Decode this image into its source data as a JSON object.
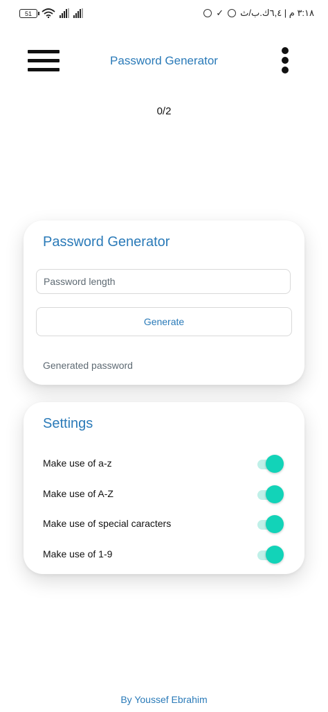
{
  "status_bar": {
    "battery": "51",
    "time_text": "٣:١٨ م | ٦,٤ك.ب/ث"
  },
  "app_bar": {
    "title": "Password Generator",
    "menu_icon": "hamburger-menu-icon",
    "more_icon": "more-vertical-icon"
  },
  "counter": "0/2",
  "generator_card": {
    "title": "Password Generator",
    "length_placeholder": "Password length",
    "length_value": "",
    "generate_label": "Generate",
    "output_text": "Generated password"
  },
  "settings_card": {
    "title": "Settings",
    "options": [
      {
        "label": "Make use of a-z",
        "enabled": true
      },
      {
        "label": "Make use of A-Z",
        "enabled": true
      },
      {
        "label": "Make use of special caracters",
        "enabled": true
      },
      {
        "label": "Make use of 1-9",
        "enabled": true
      }
    ]
  },
  "footer": "By Youssef Ebrahim",
  "colors": {
    "accent": "#2a7ab8",
    "switch_on": "#12d3b8",
    "switch_track": "#bff0e8"
  }
}
